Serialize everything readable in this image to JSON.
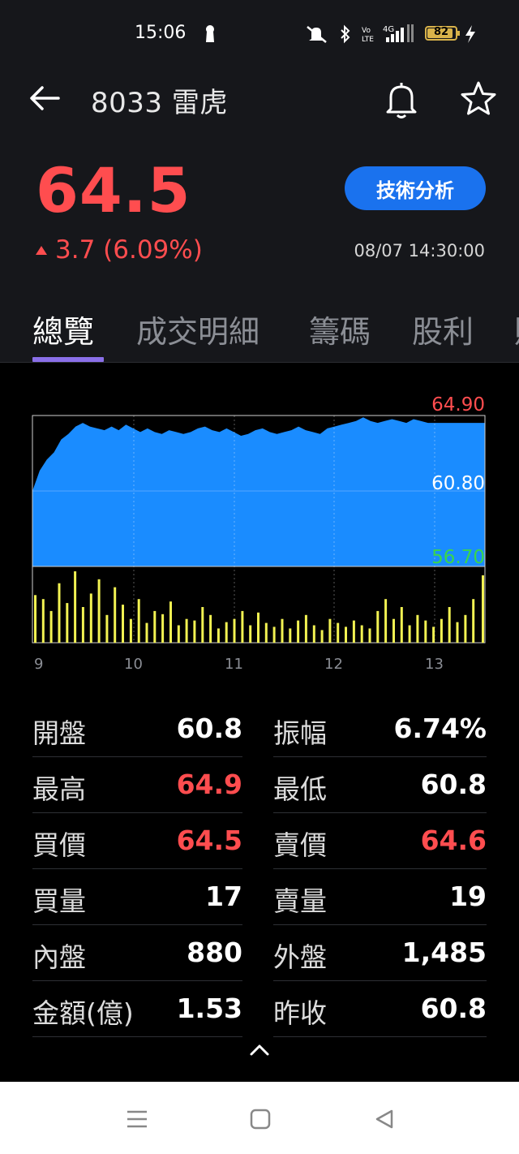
{
  "status_bar": {
    "time": "15:06",
    "battery": "82",
    "network": "4G"
  },
  "header": {
    "title": "8033 雷虎"
  },
  "quote": {
    "price": "64.5",
    "change": "3.7 (6.09%)",
    "timestamp": "08/07 14:30:00",
    "tech_button": "技術分析"
  },
  "tabs": [
    "總覽",
    "成交明細",
    "籌碼",
    "股利",
    "財"
  ],
  "chart_data": {
    "type": "area",
    "price_labels": {
      "high": "64.90",
      "ref": "60.80",
      "low": "56.70"
    },
    "ylim": [
      56.7,
      64.9
    ],
    "x_ticks": [
      "9",
      "10",
      "11",
      "12",
      "13"
    ],
    "grid": true,
    "series": [
      {
        "values": [
          60.8,
          61.9,
          62.5,
          62.9,
          63.6,
          63.9,
          64.3,
          64.5,
          64.3,
          64.2,
          64.1,
          64.3,
          64.1,
          64.4,
          64.2,
          64.0,
          64.2,
          64.0,
          63.9,
          64.1,
          64.0,
          63.9,
          64.0,
          64.2,
          64.3,
          64.1,
          64.0,
          64.2,
          64.0,
          63.8,
          63.9,
          64.1,
          64.2,
          64.0,
          63.9,
          64.0,
          64.1,
          64.3,
          64.1,
          64.0,
          63.9,
          64.2,
          64.3,
          64.4,
          64.5,
          64.6,
          64.8,
          64.6,
          64.5,
          64.6,
          64.7,
          64.6,
          64.5,
          64.7,
          64.6,
          64.5,
          64.5
        ]
      },
      {
        "values": [
          60,
          55,
          40,
          75,
          50,
          90,
          45,
          62,
          80,
          35,
          70,
          48,
          30,
          55,
          25,
          40,
          36,
          52,
          22,
          30,
          28,
          45,
          35,
          18,
          26,
          30,
          40,
          22,
          38,
          25,
          20,
          30,
          18,
          28,
          35,
          22,
          16,
          30,
          25,
          20,
          28,
          22,
          18,
          40,
          55,
          30,
          45,
          22,
          35,
          28,
          20,
          30,
          45,
          26,
          35,
          55,
          85
        ]
      }
    ]
  },
  "stats": [
    {
      "label": "開盤",
      "value": "60.8",
      "label2": "振幅",
      "value2": "6.74%",
      "red": false,
      "red2": false
    },
    {
      "label": "最高",
      "value": "64.9",
      "label2": "最低",
      "value2": "60.8",
      "red": true,
      "red2": false
    },
    {
      "label": "買價",
      "value": "64.5",
      "label2": "賣價",
      "value2": "64.6",
      "red": true,
      "red2": true
    },
    {
      "label": "買量",
      "value": "17",
      "label2": "賣量",
      "value2": "19",
      "red": false,
      "red2": false
    },
    {
      "label": "內盤",
      "value": "880",
      "label2": "外盤",
      "value2": "1,485",
      "red": false,
      "red2": false
    },
    {
      "label": "金額(億)",
      "value": "1.53",
      "label2": "昨收",
      "value2": "60.8",
      "red": false,
      "red2": false
    }
  ],
  "colors": {
    "up": "#ff4d4f",
    "area": "#1a8cff",
    "volume": "#f2f252",
    "accent": "#1a72ee",
    "tab_underline": "#8a6fe8",
    "low_label": "#3bd64a"
  }
}
